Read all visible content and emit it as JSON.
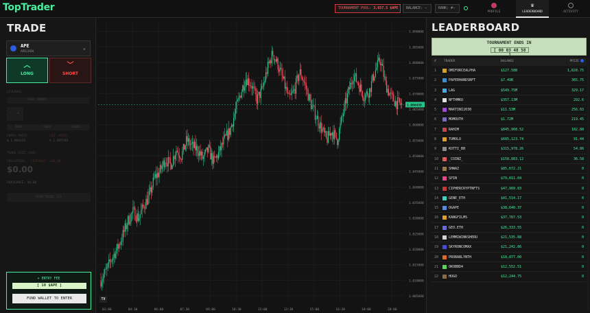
{
  "app": {
    "logo": "TopTrader"
  },
  "topbar": {
    "pool_label": "TOURNAMENT POOL",
    "pool_value": "3,657.5 $APE",
    "balance": "BALANCE: —",
    "rank": "RANK: #—",
    "tabs": [
      {
        "label": "PROFILE",
        "icon": "profile-avatar-icon"
      },
      {
        "label": "LEADERBOARD",
        "icon": "trophy-icon",
        "active": true
      },
      {
        "label": "ACTIVITY",
        "icon": "activity-icon"
      }
    ]
  },
  "trade": {
    "title": "TRADE",
    "asset_symbol": "APE",
    "asset_name": "APECOIN",
    "long_label": "LONG",
    "short_label": "SHORT",
    "leverage_label": "LEVERAGE",
    "leverage_value": "100X  1000X",
    "step_minus": "-",
    "step_plus": "+",
    "presets": [
      "100X",
      "500X",
      "1000X"
    ],
    "entry_price_label": "ENTRY PRICE",
    "entry_price": "$ 1.066439",
    "liq_price_label": "LIQ. PRICE",
    "liq_price": "$ 1.065788",
    "trade_size_label": "TRADE SIZE (USD)",
    "collateral_label": "COLLATERAL",
    "collateral_hint": "LEVERAGE: 100.00",
    "amount": "$0.00",
    "available": "AVAILABLE: $0.00",
    "open_trade": "OPEN TRADE (1)",
    "entry_fee_label": "ENTRY FEE",
    "entry_fee_value": "[ 10 $APE ]",
    "fund_button": "FUND WALLET TO ENTER",
    "chart_logo": "TV"
  },
  "chart_data": {
    "type": "candlestick",
    "y_ticks": [
      "1.090000",
      "1.085000",
      "1.080000",
      "1.075000",
      "1.070000",
      "1.065000",
      "1.060000",
      "1.055000",
      "1.050000",
      "1.045000",
      "1.040000",
      "1.035000",
      "1.030000",
      "1.025000",
      "1.020000",
      "1.015000",
      "1.010000",
      "1.005000"
    ],
    "ylim": [
      1.003,
      1.093
    ],
    "x_ticks": [
      "03:00",
      "04:30",
      "06:00",
      "07:30",
      "09:00",
      "10:30",
      "12:00",
      "13:30",
      "15:00",
      "16:30",
      "18:00",
      "20:00"
    ],
    "last_price": "1.066439",
    "close_path": [
      1.01,
      1.013,
      1.017,
      1.02,
      1.024,
      1.029,
      1.032,
      1.03,
      1.034,
      1.037,
      1.043,
      1.045,
      1.049,
      1.047,
      1.052,
      1.05,
      1.055,
      1.053,
      1.052,
      1.049,
      1.052,
      1.048,
      1.051,
      1.055,
      1.058,
      1.064,
      1.07,
      1.075,
      1.073,
      1.068,
      1.071,
      1.078,
      1.083,
      1.079,
      1.074,
      1.068,
      1.071,
      1.077,
      1.073,
      1.067,
      1.063,
      1.059,
      1.055,
      1.058,
      1.055,
      1.063,
      1.07,
      1.076,
      1.073,
      1.069,
      1.071,
      1.077,
      1.081,
      1.073,
      1.069,
      1.067,
      1.066439
    ],
    "colors": {
      "up": "#26c48a",
      "down": "#ff4d5e"
    }
  },
  "leaderboard": {
    "title": "LEADERBOARD",
    "ends_label": "TOURNAMENT ENDS IN",
    "ends_value": "[ 00 03 48 58 ]",
    "headers": {
      "rank": "#",
      "trader": "TRADER",
      "balance": "BALANCE",
      "prize": "PRIZE"
    },
    "rows": [
      {
        "rank": "1",
        "name": "OMIFORCEALPHA",
        "balance": "$127.58B",
        "prize": "1,828.75",
        "color": "#d4a028"
      },
      {
        "rank": "2",
        "name": "PAPERHANDSNFT",
        "balance": "$7.49B",
        "prize": "365.75",
        "color": "#3a8fd4"
      },
      {
        "rank": "3",
        "name": "LAG",
        "balance": "$549.75M",
        "prize": "329.17",
        "color": "#4aa8e0"
      },
      {
        "rank": "4",
        "name": "NFTHMKU",
        "balance": "$357.13M",
        "prize": "292.6",
        "color": "#e0e0e0"
      },
      {
        "rank": "5",
        "name": "MARTINI2030",
        "balance": "$11.53M",
        "prize": "256.03",
        "color": "#a04ad4"
      },
      {
        "rank": "6",
        "name": "MOMOUTH",
        "balance": "$1.72M",
        "prize": "219.45",
        "color": "#7a6ac0"
      },
      {
        "rank": "7",
        "name": "RAHIM",
        "balance": "$845,908.52",
        "prize": "182.88",
        "color": "#c04848"
      },
      {
        "rank": "8",
        "name": "TUMOLO",
        "balance": "$685,123.74",
        "prize": "91.44",
        "color": "#e0a030"
      },
      {
        "rank": "9",
        "name": "KOTTI_BB",
        "balance": "$315,978.26",
        "prize": "54.86",
        "color": "#8a8a8a"
      },
      {
        "rank": "10",
        "name": "_COINZ_",
        "balance": "$158,883.12",
        "prize": "36.58",
        "color": "#e05a5a"
      },
      {
        "rank": "11",
        "name": "SHWAZ",
        "balance": "$85,672.21",
        "prize": "0",
        "color": "#9a7a4a"
      },
      {
        "rank": "12",
        "name": "SPIN",
        "balance": "$79,011.04",
        "prize": "0",
        "color": "#e04a8a"
      },
      {
        "rank": "13",
        "name": "CIPHERCRYPTNFTS",
        "balance": "$47,989.83",
        "prize": "0",
        "color": "#c03a3a"
      },
      {
        "rank": "14",
        "name": "GENE_ETH",
        "balance": "$41,514.17",
        "prize": "0",
        "color": "#3ad4c0"
      },
      {
        "rank": "15",
        "name": "OGAPE",
        "balance": "$38,640.37",
        "prize": "0",
        "color": "#5a8ae0"
      },
      {
        "rank": "16",
        "name": "KANGFILMS",
        "balance": "$37,787.53",
        "prize": "0",
        "color": "#e0a030"
      },
      {
        "rank": "17",
        "name": "GEO.ETH",
        "balance": "$26,333.55",
        "prize": "0",
        "color": "#6a6ad4"
      },
      {
        "rank": "18",
        "name": "LEMMIWINKSHERU",
        "balance": "$21,535.88",
        "prize": "0",
        "color": "#d4d4d4"
      },
      {
        "rank": "19",
        "name": "SKYRONCOMAX",
        "balance": "$21,242.86",
        "prize": "0",
        "color": "#4a4ad4"
      },
      {
        "rank": "20",
        "name": "PROBABLYNTH",
        "balance": "$18,877.00",
        "prize": "0",
        "color": "#e06a2a"
      },
      {
        "rank": "21",
        "name": "OKOBBD4",
        "balance": "$12,552.51",
        "prize": "0",
        "color": "#5ad45a"
      },
      {
        "rank": "22",
        "name": "HUGO",
        "balance": "$12,244.75",
        "prize": "0",
        "color": "#8a6a4a"
      }
    ]
  }
}
